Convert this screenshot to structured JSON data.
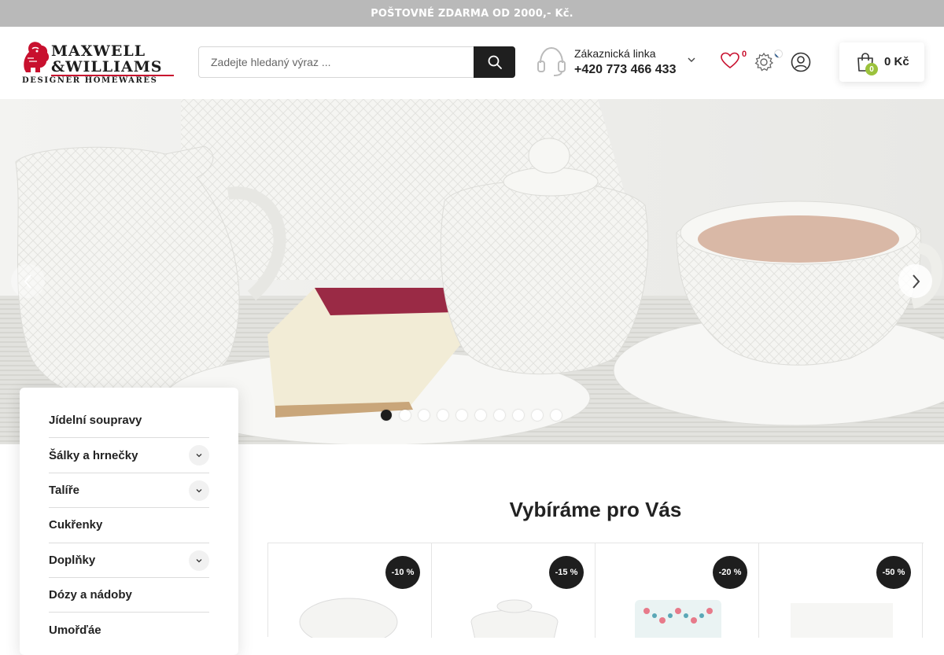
{
  "topbar": {
    "text": "POŠTOVNÉ ZDARMA OD 2000,- Kč."
  },
  "logo": {
    "line1": "MAXWELL",
    "line2": "&WILLIAMS",
    "tagline": "DESIGNER HOMEWARES",
    "trademark": "™"
  },
  "search": {
    "placeholder": "Zadejte hledaný výraz ...",
    "icon": "search-icon"
  },
  "hotline": {
    "label": "Zákaznická linka",
    "phone": "+420 773 466 433",
    "icon": "headset-icon"
  },
  "header_icons": {
    "wishlist_count": "0",
    "wishlist_icon": "heart-icon",
    "settings_icon": "gear-icon",
    "language_flag": "cz-flag-icon",
    "user_icon": "user-icon"
  },
  "cart": {
    "count": "0",
    "total": "0 Kč",
    "icon": "shopping-bag-icon"
  },
  "hero": {
    "slide_count": 10,
    "active_slide": 1,
    "colors": {
      "accent": "#c8102e",
      "dot_active": "#1c1c1c",
      "badge": "#1e1e1e",
      "cart_badge": "#9bc23c"
    }
  },
  "sidebar": {
    "items": [
      {
        "label": "Jídelní soupravy",
        "has_submenu": false
      },
      {
        "label": "Šálky a hrnečky",
        "has_submenu": true
      },
      {
        "label": "Talíře",
        "has_submenu": true
      },
      {
        "label": "Cukřenky",
        "has_submenu": false
      },
      {
        "label": "Doplňky",
        "has_submenu": true
      },
      {
        "label": "Dózy a nádoby",
        "has_submenu": false
      },
      {
        "label": "Umořďáe",
        "has_submenu": false
      }
    ]
  },
  "section": {
    "title": "Vybíráme pro Vás"
  },
  "products": [
    {
      "discount": "-10 %"
    },
    {
      "discount": "-15 %"
    },
    {
      "discount": "-20 %"
    },
    {
      "discount": "-50 %"
    }
  ]
}
